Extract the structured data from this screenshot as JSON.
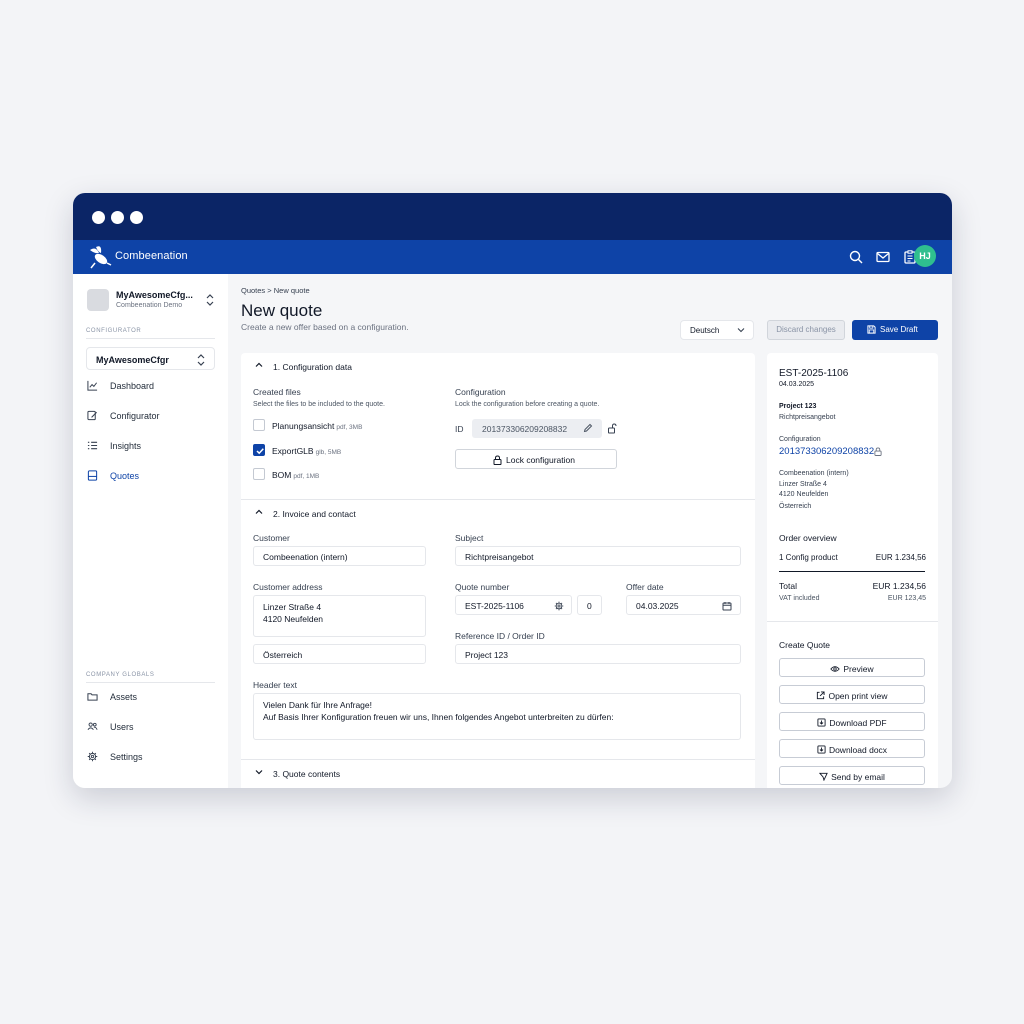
{
  "app": {
    "name": "Combeenation",
    "avatar_initials": "HJ"
  },
  "workspace": {
    "name": "MyAwesomeCfg...",
    "sub": "Combeenation Demo"
  },
  "sidebar": {
    "heading_configurator": "CONFIGURATOR",
    "configurator_select": "MyAwesomeCfgr",
    "items": [
      {
        "label": "Dashboard",
        "icon": "chart-line-icon"
      },
      {
        "label": "Configurator",
        "icon": "edit-icon"
      },
      {
        "label": "Insights",
        "icon": "list-icon"
      },
      {
        "label": "Quotes",
        "icon": "quotes-icon",
        "active": true
      }
    ],
    "heading_globals": "COMPANY GLOBALS",
    "globals": [
      {
        "label": "Assets",
        "icon": "folder-icon"
      },
      {
        "label": "Users",
        "icon": "users-icon"
      },
      {
        "label": "Settings",
        "icon": "gear-icon"
      }
    ]
  },
  "breadcrumb": {
    "parent": "Quotes",
    "separator": ">",
    "current": "New quote"
  },
  "page": {
    "title": "New quote",
    "subtitle": "Create a new offer based on a configuration.",
    "language": "Deutsch",
    "discard_label": "Discard changes",
    "save_label": "Save Draft"
  },
  "section1": {
    "title": "1. Configuration data",
    "created_files_label": "Created files",
    "created_files_hint": "Select the files to be included to the quote.",
    "files": [
      {
        "name": "Planungsansicht",
        "meta": "pdf, 3MB",
        "checked": false
      },
      {
        "name": "ExportGLB",
        "meta": "glb, 5MB",
        "checked": true
      },
      {
        "name": "BOM",
        "meta": "pdf, 1MB",
        "checked": false
      }
    ],
    "configuration_label": "Configuration",
    "configuration_hint": "Lock the configuration before creating a quote.",
    "id_label": "ID",
    "id_value": "201373306209208832",
    "lock_label": "Lock configuration"
  },
  "section2": {
    "title": "2. Invoice and contact",
    "customer_label": "Customer",
    "customer_value": "Combeenation (intern)",
    "subject_label": "Subject",
    "subject_value": "Richtpreisangebot",
    "address_label": "Customer address",
    "address_line1": "Linzer Straße 4",
    "address_line2": "4120 Neufelden",
    "country_value": "Österreich",
    "quote_number_label": "Quote number",
    "quote_number_value": "EST-2025-1106",
    "quote_counter": "0",
    "offer_date_label": "Offer date",
    "offer_date_value": "04.03.2025",
    "reference_label": "Reference ID / Order ID",
    "reference_value": "Project 123",
    "header_text_label": "Header text",
    "header_text_line1": "Vielen Dank für Ihre Anfrage!",
    "header_text_line2": "Auf Basis Ihrer Konfiguration freuen wir uns, Ihnen folgendes Angebot unterbreiten zu dürfen:"
  },
  "section3": {
    "title": "3. Quote contents"
  },
  "summary": {
    "quote_id": "EST-2025-1106",
    "date": "04.03.2025",
    "project": "Project 123",
    "subject": "Richtpreisangebot",
    "configuration_label": "Configuration",
    "configuration_id": "201373306209208832",
    "company": "Combeenation (intern)",
    "street": "Linzer Straße 4",
    "city": "4120 Neufelden",
    "country": "Österreich",
    "order_overview_label": "Order overview",
    "line_item_label": "1 Config product",
    "line_item_value": "EUR 1.234,56",
    "total_label": "Total",
    "total_value": "EUR 1.234,56",
    "vat_label": "VAT included",
    "vat_value": "EUR 123,45"
  },
  "create_quote": {
    "title": "Create Quote",
    "preview": "Preview",
    "print": "Open print view",
    "pdf": "Download PDF",
    "docx": "Download docx",
    "email": "Send by email"
  },
  "colors": {
    "brand_dark": "#0b2566",
    "brand": "#0e43a7",
    "avatar": "#2fbf8f"
  }
}
